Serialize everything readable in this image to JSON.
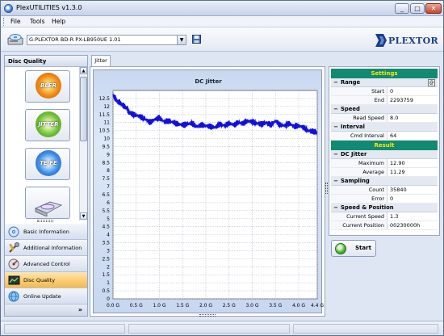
{
  "window": {
    "title": "PlexUTILITIES v1.3.0"
  },
  "menu": [
    "File",
    "Tools",
    "Help"
  ],
  "toolbar": {
    "drive": "G:PLEXTOR BD-R  PX-LB950UE 1.01",
    "logo_text": "PLEXTOR"
  },
  "left_panel": {
    "header": "Disc Quality",
    "quality_buttons": [
      "BLER",
      "JITTER",
      "TE/FE"
    ],
    "nav_items": [
      {
        "label": "Basic Information",
        "icon": "disc-info-icon"
      },
      {
        "label": "Additional Information",
        "icon": "tools-icon"
      },
      {
        "label": "Advanced Control",
        "icon": "control-icon"
      },
      {
        "label": "Disc Quality",
        "icon": "disc-quality-icon",
        "active": true
      },
      {
        "label": "Online Update",
        "icon": "globe-icon"
      }
    ]
  },
  "tab": "Jitter",
  "chart_data": {
    "type": "line",
    "title": "DC Jitter",
    "xlabel": "",
    "ylabel": "",
    "xlim": [
      0,
      4.4
    ],
    "ylim": [
      0,
      13
    ],
    "x_ticks": [
      "0.0 G",
      "0.5 G",
      "1.0 G",
      "1.5 G",
      "2.0 G",
      "2.5 G",
      "3.0 G",
      "3.5 G",
      "4.0 G",
      "4.4 G"
    ],
    "y_ticks": [
      "0",
      "0.5",
      "1",
      "1.5",
      "2",
      "2.5",
      "3",
      "3.5",
      "4",
      "4.5",
      "5",
      "5.5",
      "6",
      "6.5",
      "7",
      "7.5",
      "8",
      "8.5",
      "9",
      "9.5",
      "10",
      "10.5",
      "11",
      "11.5",
      "12",
      "12.5"
    ],
    "grid": true,
    "series": [
      {
        "color": "#1010e0",
        "x": [
          0.0,
          0.05,
          0.1,
          0.15,
          0.2,
          0.25,
          0.3,
          0.35,
          0.4,
          0.5,
          0.6,
          0.7,
          0.8,
          0.9,
          1.0,
          1.1,
          1.2,
          1.3,
          1.4,
          1.5,
          1.6,
          1.7,
          1.8,
          1.9,
          2.0,
          2.1,
          2.2,
          2.3,
          2.4,
          2.5,
          2.6,
          2.7,
          2.8,
          2.9,
          3.0,
          3.1,
          3.2,
          3.3,
          3.4,
          3.5,
          3.6,
          3.7,
          3.8,
          3.9,
          4.0,
          4.1,
          4.2,
          4.3,
          4.39
        ],
        "y": [
          12.7,
          12.5,
          12.3,
          12.25,
          12.1,
          12.0,
          11.9,
          11.6,
          11.55,
          11.45,
          11.35,
          11.2,
          11.0,
          11.2,
          11.3,
          11.05,
          11.1,
          11.0,
          10.9,
          10.85,
          10.9,
          10.95,
          10.75,
          10.85,
          10.8,
          10.75,
          10.7,
          10.9,
          10.8,
          10.95,
          10.85,
          11.0,
          10.95,
          11.1,
          11.05,
          10.95,
          10.9,
          11.0,
          10.85,
          11.1,
          10.85,
          10.8,
          10.95,
          10.75,
          10.8,
          10.7,
          10.5,
          10.45,
          10.4
        ]
      }
    ]
  },
  "settings": {
    "header": "Settings",
    "range": {
      "label": "Range",
      "start_label": "Start",
      "start": "0",
      "end_label": "End",
      "end": "2293759"
    },
    "speed": {
      "label": "Speed",
      "read_label": "Read Speed",
      "read": "8.0"
    },
    "interval": {
      "label": "Interval",
      "cmd_label": "Cmd Interval",
      "cmd": "64"
    }
  },
  "result": {
    "header": "Result",
    "dc_jitter": {
      "label": "DC Jitter",
      "max_label": "Maximum",
      "max": "12.90",
      "avg_label": "Average",
      "avg": "11.29"
    },
    "sampling": {
      "label": "Sampling",
      "count_label": "Count",
      "count": "35840",
      "error_label": "Error",
      "error": "0"
    },
    "speed_position": {
      "label": "Speed & Position",
      "speed_label": "Current Speed",
      "speed": "1.3",
      "pos_label": "Current Position",
      "pos": "00230000h"
    }
  },
  "start_button": "Start"
}
